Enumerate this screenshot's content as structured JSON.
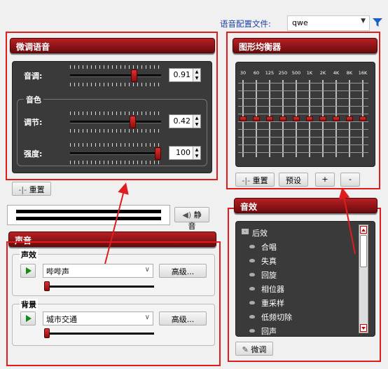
{
  "config": {
    "label": "语音配置文件:",
    "value": "qwe"
  },
  "tune": {
    "title": "微调语音",
    "pitch_label": "音调:",
    "pitch_value": "0.91",
    "pitch_level": 0.72,
    "timbre_title": "音色",
    "adjust_label": "调节:",
    "adjust_value": "0.42",
    "adjust_level": 0.7,
    "strength_label": "强度:",
    "strength_value": "100",
    "strength_level": 1.0,
    "reset_label": "重置"
  },
  "equalizer": {
    "title": "图形均衡器",
    "bands": [
      "30",
      "60",
      "125",
      "250",
      "500",
      "1K",
      "2K",
      "4K",
      "8K",
      "16K"
    ],
    "reset_label": "重置",
    "preset_label": "预设",
    "add_label": "+",
    "remove_label": "-"
  },
  "mute_label": "静音",
  "sound": {
    "title": "声音",
    "effects_group": {
      "title": "声效",
      "selected": "哔哔声",
      "advanced_label": "高级..."
    },
    "background_group": {
      "title": "背景",
      "selected": "城市交通",
      "advanced_label": "高级..."
    }
  },
  "effects": {
    "title": "音效",
    "root_label": "后效",
    "items": [
      "合唱",
      "失真",
      "回旋",
      "相位器",
      "重采样",
      "低频切除",
      "回声"
    ],
    "tune_label": "微调"
  },
  "colors": {
    "header_red": "#8a1216",
    "thumb_red": "#d42a2a",
    "annotation": "#e01c1c"
  }
}
